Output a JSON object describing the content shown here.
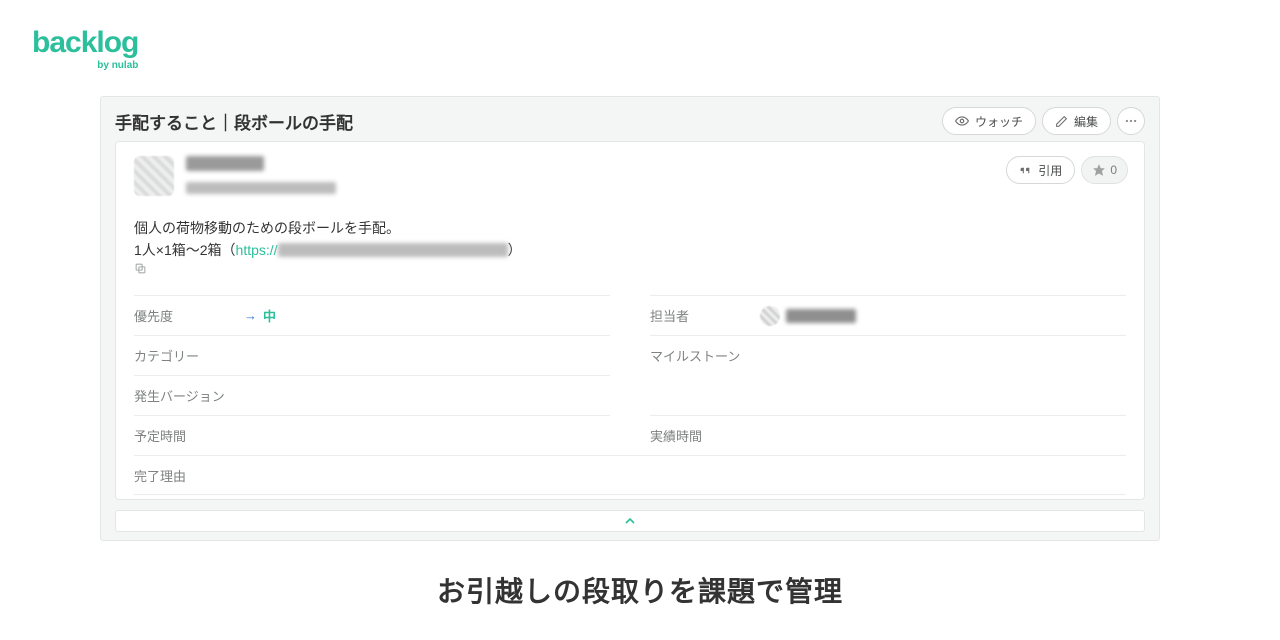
{
  "logo": {
    "main": "backlog",
    "sub": "by nulab"
  },
  "header": {
    "title": "手配すること｜段ボールの手配",
    "watch_label": "ウォッチ",
    "edit_label": "編集"
  },
  "card": {
    "quote_label": "引用",
    "star_count": "0",
    "body_line1": "個人の荷物移動のための段ボールを手配。",
    "body_line2_prefix": "1人×1箱～2箱（",
    "body_line2_link": "https://",
    "body_line2_suffix": "）"
  },
  "fields": {
    "priority_label": "優先度",
    "priority_value": "中",
    "assignee_label": "担当者",
    "category_label": "カテゴリー",
    "milestone_label": "マイルストーン",
    "version_label": "発生バージョン",
    "estimate_label": "予定時間",
    "actual_label": "実績時間",
    "resolution_label": "完了理由"
  },
  "caption": "お引越しの段取りを課題で管理"
}
